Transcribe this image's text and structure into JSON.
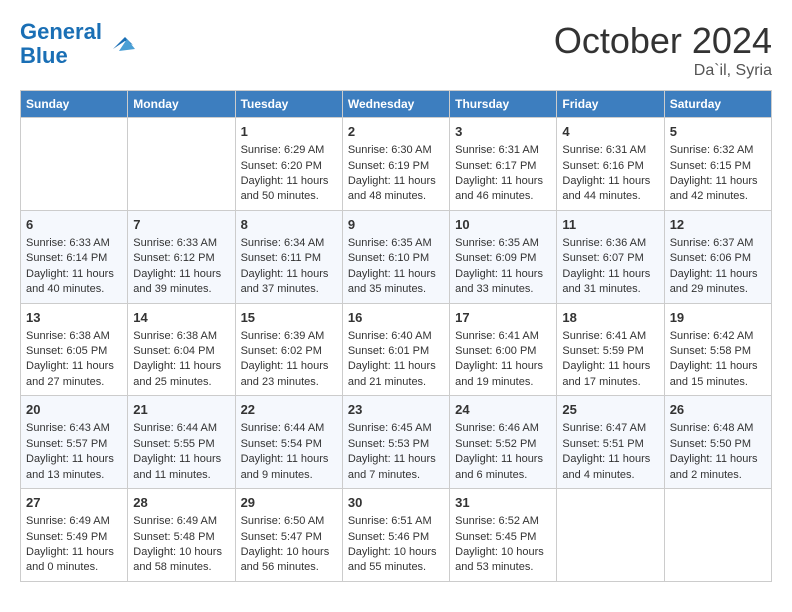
{
  "logo": {
    "line1": "General",
    "line2": "Blue"
  },
  "title": "October 2024",
  "location": "Da`il, Syria",
  "days_of_week": [
    "Sunday",
    "Monday",
    "Tuesday",
    "Wednesday",
    "Thursday",
    "Friday",
    "Saturday"
  ],
  "weeks": [
    [
      {
        "day": "",
        "content": ""
      },
      {
        "day": "",
        "content": ""
      },
      {
        "day": "1",
        "content": "Sunrise: 6:29 AM\nSunset: 6:20 PM\nDaylight: 11 hours and 50 minutes."
      },
      {
        "day": "2",
        "content": "Sunrise: 6:30 AM\nSunset: 6:19 PM\nDaylight: 11 hours and 48 minutes."
      },
      {
        "day": "3",
        "content": "Sunrise: 6:31 AM\nSunset: 6:17 PM\nDaylight: 11 hours and 46 minutes."
      },
      {
        "day": "4",
        "content": "Sunrise: 6:31 AM\nSunset: 6:16 PM\nDaylight: 11 hours and 44 minutes."
      },
      {
        "day": "5",
        "content": "Sunrise: 6:32 AM\nSunset: 6:15 PM\nDaylight: 11 hours and 42 minutes."
      }
    ],
    [
      {
        "day": "6",
        "content": "Sunrise: 6:33 AM\nSunset: 6:14 PM\nDaylight: 11 hours and 40 minutes."
      },
      {
        "day": "7",
        "content": "Sunrise: 6:33 AM\nSunset: 6:12 PM\nDaylight: 11 hours and 39 minutes."
      },
      {
        "day": "8",
        "content": "Sunrise: 6:34 AM\nSunset: 6:11 PM\nDaylight: 11 hours and 37 minutes."
      },
      {
        "day": "9",
        "content": "Sunrise: 6:35 AM\nSunset: 6:10 PM\nDaylight: 11 hours and 35 minutes."
      },
      {
        "day": "10",
        "content": "Sunrise: 6:35 AM\nSunset: 6:09 PM\nDaylight: 11 hours and 33 minutes."
      },
      {
        "day": "11",
        "content": "Sunrise: 6:36 AM\nSunset: 6:07 PM\nDaylight: 11 hours and 31 minutes."
      },
      {
        "day": "12",
        "content": "Sunrise: 6:37 AM\nSunset: 6:06 PM\nDaylight: 11 hours and 29 minutes."
      }
    ],
    [
      {
        "day": "13",
        "content": "Sunrise: 6:38 AM\nSunset: 6:05 PM\nDaylight: 11 hours and 27 minutes."
      },
      {
        "day": "14",
        "content": "Sunrise: 6:38 AM\nSunset: 6:04 PM\nDaylight: 11 hours and 25 minutes."
      },
      {
        "day": "15",
        "content": "Sunrise: 6:39 AM\nSunset: 6:02 PM\nDaylight: 11 hours and 23 minutes."
      },
      {
        "day": "16",
        "content": "Sunrise: 6:40 AM\nSunset: 6:01 PM\nDaylight: 11 hours and 21 minutes."
      },
      {
        "day": "17",
        "content": "Sunrise: 6:41 AM\nSunset: 6:00 PM\nDaylight: 11 hours and 19 minutes."
      },
      {
        "day": "18",
        "content": "Sunrise: 6:41 AM\nSunset: 5:59 PM\nDaylight: 11 hours and 17 minutes."
      },
      {
        "day": "19",
        "content": "Sunrise: 6:42 AM\nSunset: 5:58 PM\nDaylight: 11 hours and 15 minutes."
      }
    ],
    [
      {
        "day": "20",
        "content": "Sunrise: 6:43 AM\nSunset: 5:57 PM\nDaylight: 11 hours and 13 minutes."
      },
      {
        "day": "21",
        "content": "Sunrise: 6:44 AM\nSunset: 5:55 PM\nDaylight: 11 hours and 11 minutes."
      },
      {
        "day": "22",
        "content": "Sunrise: 6:44 AM\nSunset: 5:54 PM\nDaylight: 11 hours and 9 minutes."
      },
      {
        "day": "23",
        "content": "Sunrise: 6:45 AM\nSunset: 5:53 PM\nDaylight: 11 hours and 7 minutes."
      },
      {
        "day": "24",
        "content": "Sunrise: 6:46 AM\nSunset: 5:52 PM\nDaylight: 11 hours and 6 minutes."
      },
      {
        "day": "25",
        "content": "Sunrise: 6:47 AM\nSunset: 5:51 PM\nDaylight: 11 hours and 4 minutes."
      },
      {
        "day": "26",
        "content": "Sunrise: 6:48 AM\nSunset: 5:50 PM\nDaylight: 11 hours and 2 minutes."
      }
    ],
    [
      {
        "day": "27",
        "content": "Sunrise: 6:49 AM\nSunset: 5:49 PM\nDaylight: 11 hours and 0 minutes."
      },
      {
        "day": "28",
        "content": "Sunrise: 6:49 AM\nSunset: 5:48 PM\nDaylight: 10 hours and 58 minutes."
      },
      {
        "day": "29",
        "content": "Sunrise: 6:50 AM\nSunset: 5:47 PM\nDaylight: 10 hours and 56 minutes."
      },
      {
        "day": "30",
        "content": "Sunrise: 6:51 AM\nSunset: 5:46 PM\nDaylight: 10 hours and 55 minutes."
      },
      {
        "day": "31",
        "content": "Sunrise: 6:52 AM\nSunset: 5:45 PM\nDaylight: 10 hours and 53 minutes."
      },
      {
        "day": "",
        "content": ""
      },
      {
        "day": "",
        "content": ""
      }
    ]
  ]
}
